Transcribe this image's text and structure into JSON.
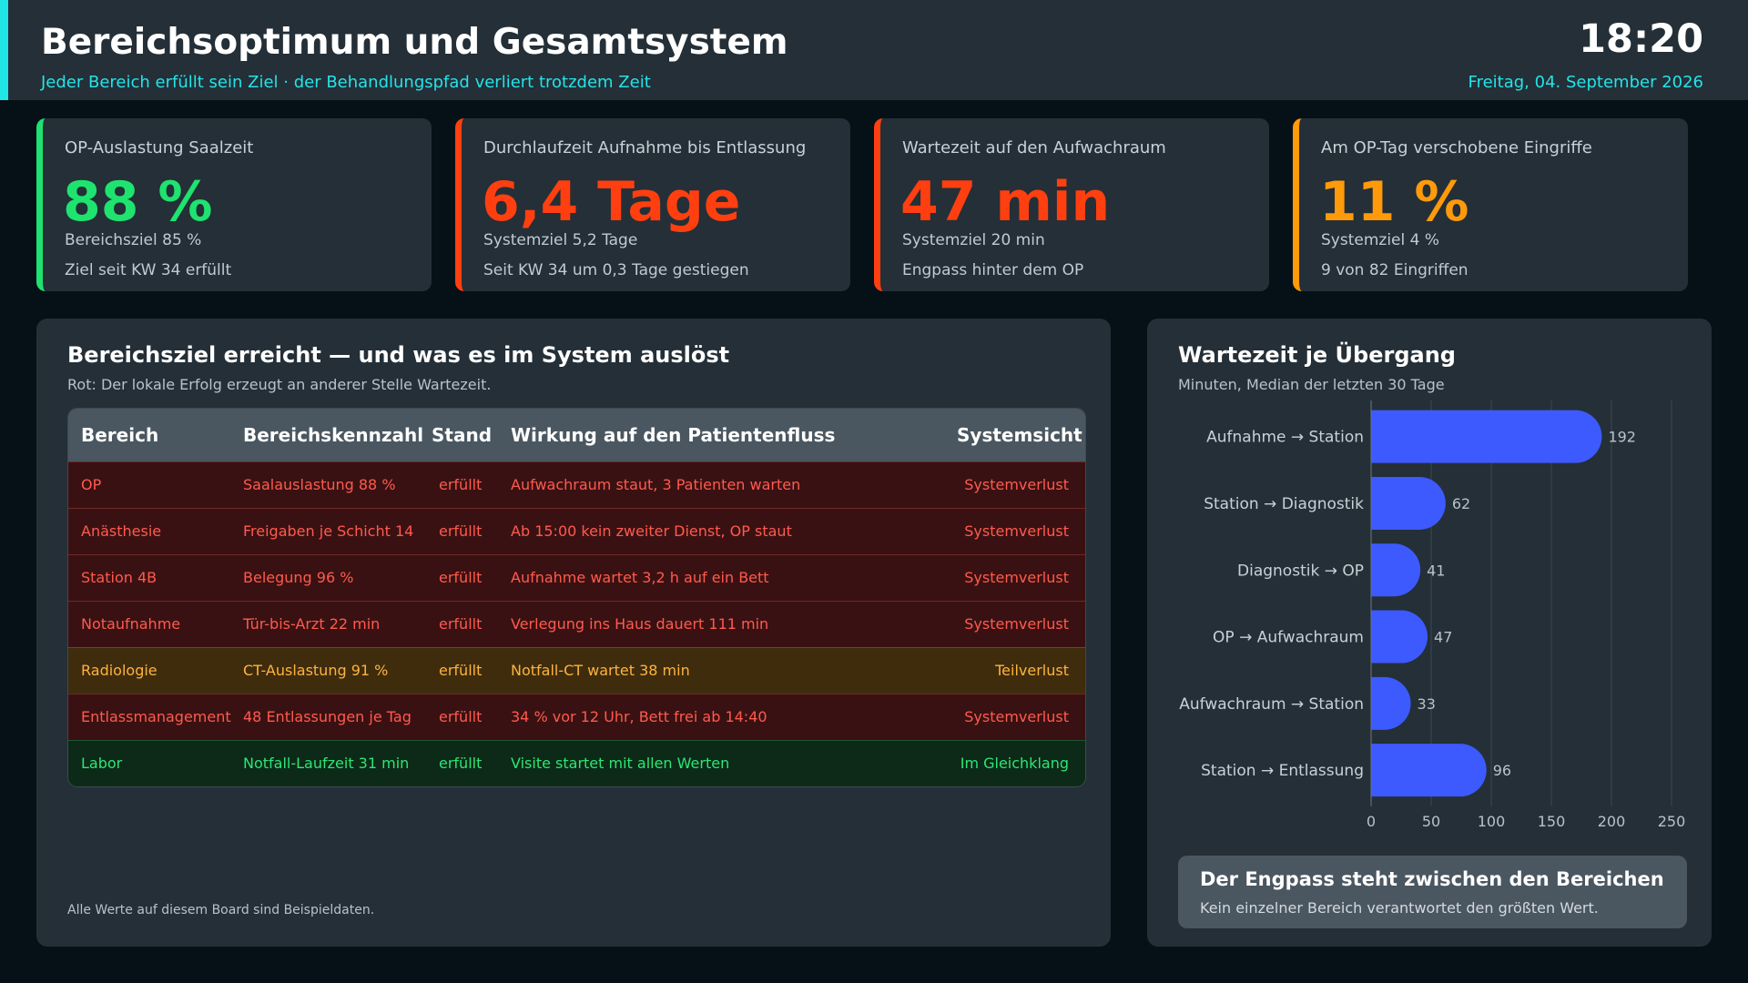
{
  "header": {
    "title": "Bereichsoptimum und Gesamtsystem",
    "subtitle": "Jeder Bereich erfüllt sein Ziel · der Behandlungspfad verliert trotzdem Zeit",
    "time": "18:20",
    "date": "Freitag, 04. September 2026"
  },
  "kpis": [
    {
      "label": "OP-Auslastung Saalzeit",
      "value": "88 %",
      "target": "Bereichsziel 85 %",
      "note": "Ziel seit KW 34 erfüllt",
      "color": "#1ee36f"
    },
    {
      "label": "Durchlaufzeit Aufnahme bis Entlassung",
      "value": "6,4 Tage",
      "target": "Systemziel 5,2 Tage",
      "note": "Seit KW 34 um 0,3 Tage gestiegen",
      "color": "#ff3f10"
    },
    {
      "label": "Wartezeit auf den Aufwachraum",
      "value": "47 min",
      "target": "Systemziel 20 min",
      "note": "Engpass hinter dem OP",
      "color": "#ff3f10"
    },
    {
      "label": "Am OP-Tag verschobene Eingriffe",
      "value": "11 %",
      "target": "Systemziel 4 %",
      "note": "9 von 82 Eingriffen",
      "color": "#ff9a0a"
    }
  ],
  "table_panel": {
    "title": "Bereichsziel erreicht — und was es im System auslöst",
    "subtitle": "Rot: Der lokale Erfolg erzeugt an anderer Stelle Wartezeit.",
    "columns": [
      "Bereich",
      "Bereichskennzahl",
      "Stand",
      "Wirkung auf den Patientenfluss",
      "Systemsicht"
    ],
    "rows": [
      {
        "area": "OP",
        "metric": "Saalauslastung 88 %",
        "status": "erfüllt",
        "effect": "Aufwachraum staut, 3 Patienten warten",
        "view": "Systemverlust",
        "level": "loss"
      },
      {
        "area": "Anästhesie",
        "metric": "Freigaben je Schicht 14",
        "status": "erfüllt",
        "effect": "Ab 15:00 kein zweiter Dienst, OP staut",
        "view": "Systemverlust",
        "level": "loss"
      },
      {
        "area": "Station 4B",
        "metric": "Belegung 96 %",
        "status": "erfüllt",
        "effect": "Aufnahme wartet 3,2 h auf ein Bett",
        "view": "Systemverlust",
        "level": "loss"
      },
      {
        "area": "Notaufnahme",
        "metric": "Tür-bis-Arzt 22 min",
        "status": "erfüllt",
        "effect": "Verlegung ins Haus dauert 111 min",
        "view": "Systemverlust",
        "level": "loss"
      },
      {
        "area": "Radiologie",
        "metric": "CT-Auslastung 91 %",
        "status": "erfüllt",
        "effect": "Notfall-CT wartet 38 min",
        "view": "Teilverlust",
        "level": "partial"
      },
      {
        "area": "Entlassmanagement",
        "metric": "48 Entlassungen je Tag",
        "status": "erfüllt",
        "effect": "34 % vor 12 Uhr, Bett frei ab 14:40",
        "view": "Systemverlust",
        "level": "loss"
      },
      {
        "area": "Labor",
        "metric": "Notfall-Laufzeit 31 min",
        "status": "erfüllt",
        "effect": "Visite startet mit allen Werten",
        "view": "Im Gleichklang",
        "level": "ok"
      }
    ],
    "footnote": "Alle Werte auf diesem Board sind Beispieldaten."
  },
  "chart_panel": {
    "title": "Wartezeit je Übergang",
    "subtitle": "Minuten, Median der letzten 30 Tage",
    "callout_title": "Der Engpass steht zwischen den Bereichen",
    "callout_text": "Kein einzelner Bereich verantwortet den größten Wert."
  },
  "chart_data": {
    "type": "bar",
    "orientation": "horizontal",
    "categories": [
      "Aufnahme → Station",
      "Station → Diagnostik",
      "Diagnostik → OP",
      "OP → Aufwachraum",
      "Aufwachraum → Station",
      "Station → Entlassung"
    ],
    "values": [
      192,
      62,
      41,
      47,
      33,
      96
    ],
    "xlim": [
      0,
      250
    ],
    "xticks": [
      0,
      50,
      100,
      150,
      200,
      250
    ],
    "grid": true,
    "bar_color": "#3d5afe"
  }
}
